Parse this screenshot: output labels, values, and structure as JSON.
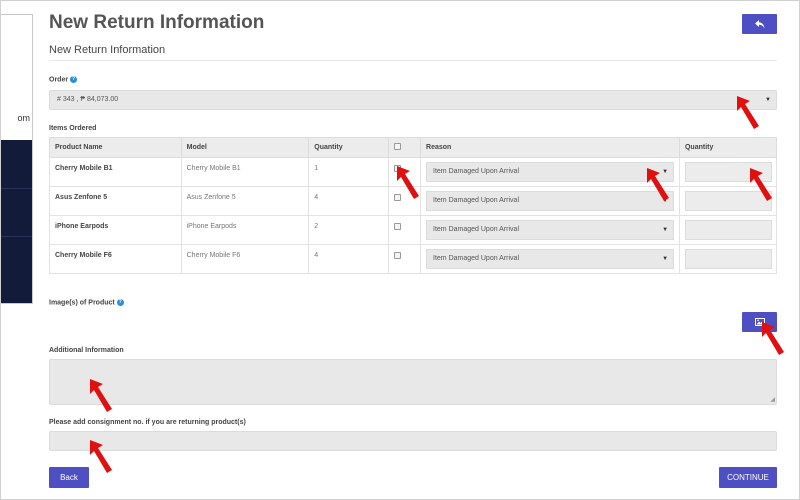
{
  "sidebar": {
    "fragment": "om"
  },
  "header": {
    "title": "New Return Information",
    "subtitle": "New Return Information"
  },
  "order": {
    "label": "Order",
    "value": "# 343 , ₱ 84,073.00"
  },
  "items": {
    "label": "Items Ordered",
    "columns": [
      "Product Name",
      "Model",
      "Quantity",
      "",
      "Reason",
      "Quantity"
    ],
    "rows": [
      {
        "name": "Cherry Mobile B1",
        "model": "Cherry Mobile B1",
        "quantity": "1",
        "reason": "Item Damaged Upon Arrival"
      },
      {
        "name": "Asus Zenfone 5",
        "model": "Asus Zenfone 5",
        "quantity": "4",
        "reason": "Item Damaged Upon Arrival"
      },
      {
        "name": "iPhone Earpods",
        "model": "iPhone Earpods",
        "quantity": "2",
        "reason": "Item Damaged Upon Arrival"
      },
      {
        "name": "Cherry Mobile F6",
        "model": "Cherry Mobile F6",
        "quantity": "4",
        "reason": "Item Damaged Upon Arrival"
      }
    ]
  },
  "images": {
    "label": "Image(s) of Product"
  },
  "additional": {
    "label": "Additional Information"
  },
  "consignment": {
    "label": "Please add consignment no. if you are returning product(s)"
  },
  "buttons": {
    "back": "Back",
    "continue": "CONTINUE"
  },
  "colors": {
    "accent": "#4e4fc3",
    "sidebar": "#121b3a",
    "annotation_arrow": "#e01010"
  },
  "icons": {
    "top_back": "reply-arrow-icon",
    "image_upload": "image-icon",
    "help": "help-circle-icon",
    "annotation": "red-arrow-icon"
  }
}
